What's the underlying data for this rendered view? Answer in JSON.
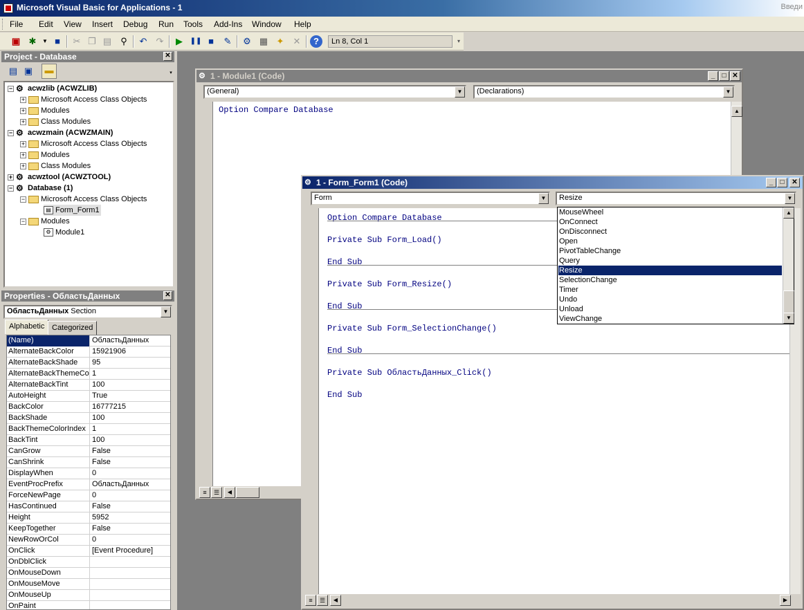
{
  "app": {
    "title": "Microsoft Visual Basic for Applications - 1",
    "right_text": "Введи"
  },
  "menu": [
    "File",
    "Edit",
    "View",
    "Insert",
    "Debug",
    "Run",
    "Tools",
    "Add-Ins",
    "Window",
    "Help"
  ],
  "toolbar": {
    "position_text": "Ln 8, Col 1"
  },
  "project": {
    "title": "Project - Database",
    "tree": [
      {
        "label": "acwzlib (ACWZLIB)",
        "bold": true
      },
      {
        "label": "Microsoft Access Class Objects"
      },
      {
        "label": "Modules"
      },
      {
        "label": "Class Modules"
      },
      {
        "label": "acwzmain (ACWZMAIN)",
        "bold": true
      },
      {
        "label": "Microsoft Access Class Objects"
      },
      {
        "label": "Modules"
      },
      {
        "label": "Class Modules"
      },
      {
        "label": "acwztool (ACWZTOOL)",
        "bold": true
      },
      {
        "label": "Database (1)",
        "bold": true
      },
      {
        "label": "Microsoft Access Class Objects"
      },
      {
        "label": "Form_Form1"
      },
      {
        "label": "Modules"
      },
      {
        "label": "Module1"
      }
    ]
  },
  "properties": {
    "title": "Properties - ОбластьДанных",
    "object_name": "ОбластьДанных",
    "object_type": "Section",
    "tabs": [
      "Alphabetic",
      "Categorized"
    ],
    "rows": [
      {
        "name": "(Name)",
        "value": "ОбластьДанных"
      },
      {
        "name": "AlternateBackColor",
        "value": "15921906"
      },
      {
        "name": "AlternateBackShade",
        "value": "95"
      },
      {
        "name": "AlternateBackThemeColc",
        "value": "1"
      },
      {
        "name": "AlternateBackTint",
        "value": "100"
      },
      {
        "name": "AutoHeight",
        "value": "True"
      },
      {
        "name": "BackColor",
        "value": "16777215"
      },
      {
        "name": "BackShade",
        "value": "100"
      },
      {
        "name": "BackThemeColorIndex",
        "value": "1"
      },
      {
        "name": "BackTint",
        "value": "100"
      },
      {
        "name": "CanGrow",
        "value": "False"
      },
      {
        "name": "CanShrink",
        "value": "False"
      },
      {
        "name": "DisplayWhen",
        "value": "0"
      },
      {
        "name": "EventProcPrefix",
        "value": "ОбластьДанных"
      },
      {
        "name": "ForceNewPage",
        "value": "0"
      },
      {
        "name": "HasContinued",
        "value": "False"
      },
      {
        "name": "Height",
        "value": "5952"
      },
      {
        "name": "KeepTogether",
        "value": "False"
      },
      {
        "name": "NewRowOrCol",
        "value": "0"
      },
      {
        "name": "OnClick",
        "value": "[Event Procedure]"
      },
      {
        "name": "OnDblClick",
        "value": ""
      },
      {
        "name": "OnMouseDown",
        "value": ""
      },
      {
        "name": "OnMouseMove",
        "value": ""
      },
      {
        "name": "OnMouseUp",
        "value": ""
      },
      {
        "name": "OnPaint",
        "value": ""
      }
    ]
  },
  "module1": {
    "title": "1 - Module1 (Code)",
    "object_combo": "(General)",
    "proc_combo": "(Declarations)",
    "code": [
      "Option Compare Database"
    ]
  },
  "form1": {
    "title": "1 - Form_Form1 (Code)",
    "object_combo": "Form",
    "proc_combo": "Resize",
    "code": [
      "Option Compare Database",
      "Private Sub Form_Load()",
      "End Sub",
      "Private Sub Form_Resize()",
      "End Sub",
      "Private Sub Form_SelectionChange()",
      "End Sub",
      "Private Sub ОбластьДанных_Click()",
      "End Sub"
    ],
    "dropdown": [
      "MouseWheel",
      "OnConnect",
      "OnDisconnect",
      "Open",
      "PivotTableChange",
      "Query",
      "Resize",
      "SelectionChange",
      "Timer",
      "Undo",
      "Unload",
      "ViewChange"
    ],
    "dropdown_selected": "Resize"
  }
}
